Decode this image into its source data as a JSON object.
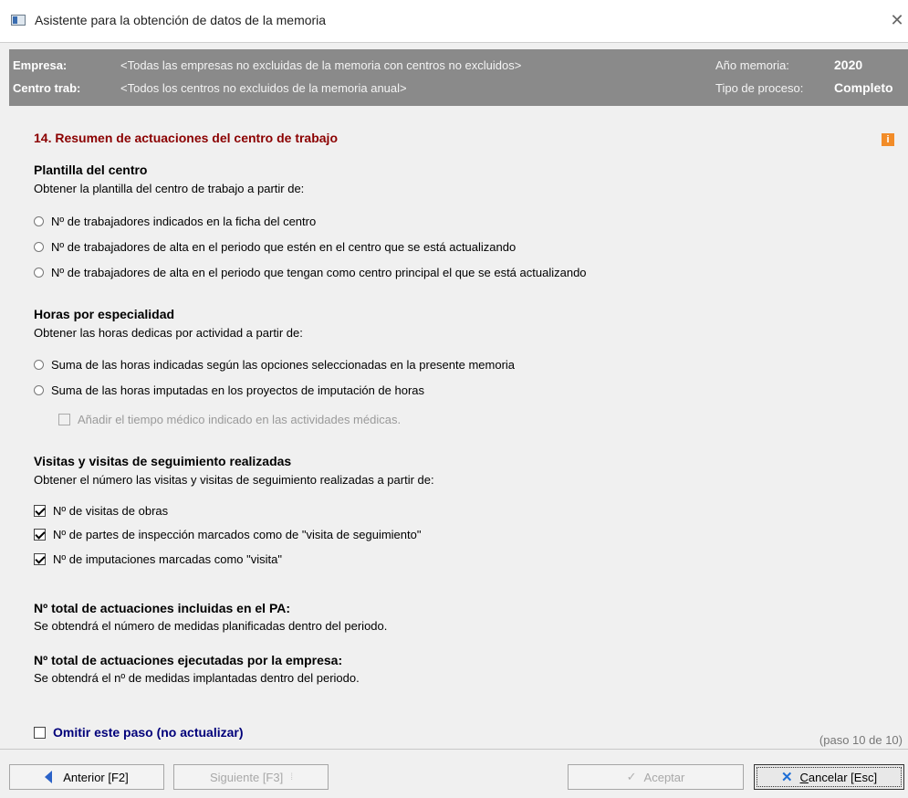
{
  "window": {
    "title": "Asistente para la obtención de datos de la memoria"
  },
  "header": {
    "empresa_label": "Empresa:",
    "empresa_value": "<Todas las empresas no excluidas de la memoria con centros no excluidos>",
    "centro_label": "Centro trab:",
    "centro_value": "<Todos los centros no excluidos de la memoria anual>",
    "anio_label": "Año memoria:",
    "anio_value": "2020",
    "proceso_label": "Tipo de proceso:",
    "proceso_value": "Completo"
  },
  "section": {
    "title": "14. Resumen de actuaciones del centro de trabajo",
    "info": "i"
  },
  "plantilla": {
    "heading": "Plantilla del centro",
    "desc": "Obtener la plantilla del centro de trabajo a partir de:",
    "options": [
      "Nº de trabajadores indicados en la ficha del centro",
      "Nº de trabajadores de alta en el periodo que estén en el centro que se está actualizando",
      "Nº de trabajadores de alta en el periodo que tengan como centro principal el que se está actualizando"
    ]
  },
  "horas": {
    "heading": "Horas por especialidad",
    "desc": "Obtener las horas dedicas por actividad a partir de:",
    "options": [
      "Suma de las horas indicadas según las opciones seleccionadas en la presente memoria",
      "Suma de las horas imputadas en los proyectos de imputación de horas"
    ],
    "sub_option": "Añadir el tiempo médico indicado en las actividades médicas."
  },
  "visitas": {
    "heading": "Visitas y visitas de seguimiento realizadas",
    "desc": "Obtener el número las visitas y visitas de seguimiento realizadas a partir de:",
    "options": [
      "Nº de visitas de obras",
      "Nº de partes de inspección marcados como de \"visita de seguimiento\"",
      "Nº de imputaciones marcadas como \"visita\""
    ]
  },
  "total_pa": {
    "heading": "Nº total de actuaciones incluidas en el PA:",
    "desc": "Se obtendrá el número de medidas planificadas dentro del periodo."
  },
  "total_ejecutadas": {
    "heading": "Nº total de actuaciones ejecutadas por la empresa:",
    "desc": "Se obtendrá el nº de medidas implantadas dentro del periodo."
  },
  "omit": {
    "label": "Omitir este paso (no actualizar)"
  },
  "step": "(paso 10 de 10)",
  "buttons": {
    "anterior": "Anterior  [F2]",
    "siguiente": "Siguiente  [F3]",
    "aceptar": "Aceptar",
    "cancelar_u": "C",
    "cancelar_rest": "ancelar  [Esc]"
  },
  "icons": {
    "prev": "arrow-left-icon",
    "next": "drag-handle-icon",
    "accept": "check-icon",
    "cancel": "close-x-icon"
  },
  "colors": {
    "header_bg": "#8a8a8a",
    "section_title": "#8b0000",
    "omit_label": "#00007a",
    "info_icon": "#f28c28"
  }
}
